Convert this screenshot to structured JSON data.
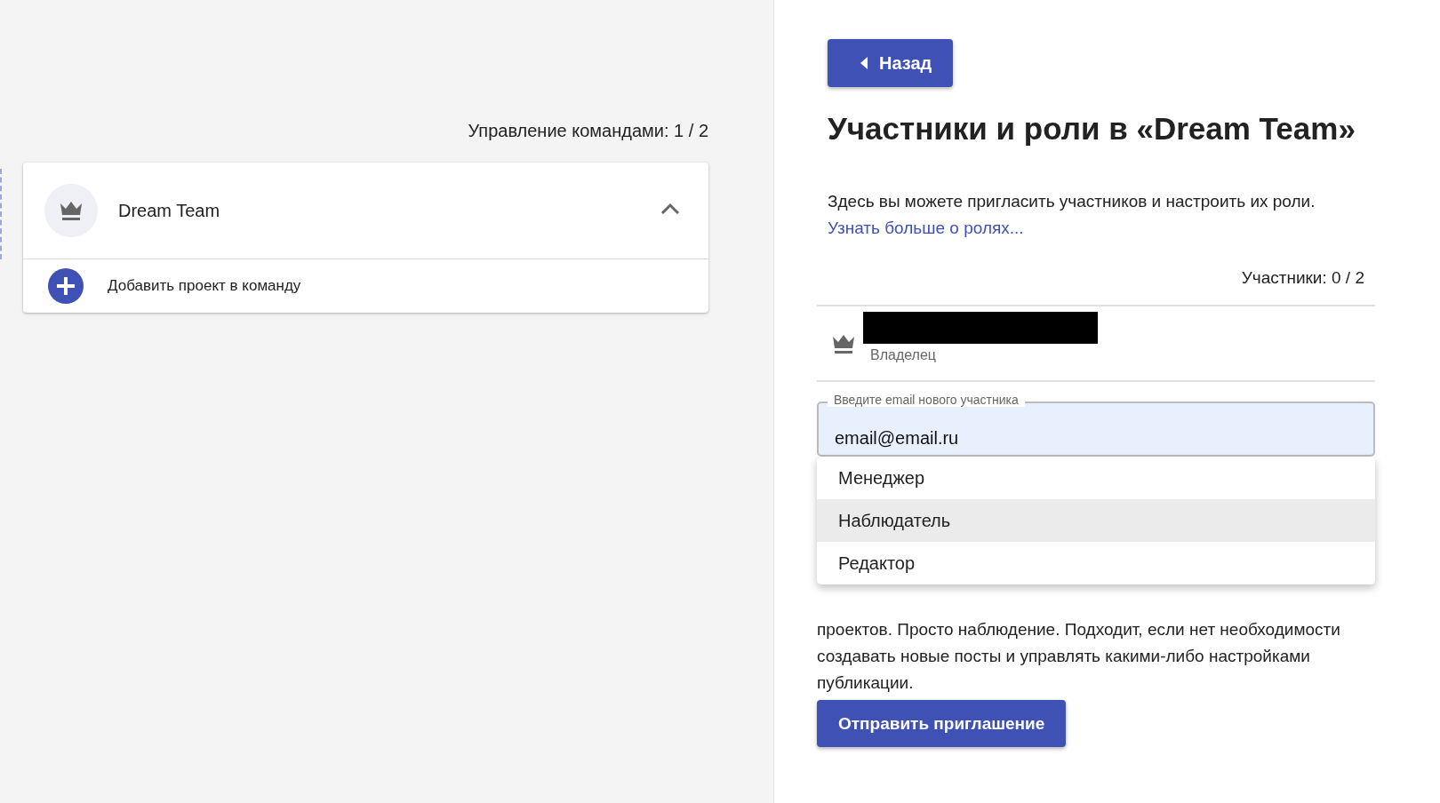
{
  "left_panel": {
    "counter": "Управление командами: 1 / 2",
    "team_card": {
      "name": "Dream Team",
      "expanded": true,
      "add_project": "Добавить проект в команду"
    }
  },
  "right_panel": {
    "back_button": "Назад",
    "title": "Участники и роли в «Dream Team»",
    "intro": "Здесь вы можете пригласить участников и настроить их роли.",
    "learn_more_link": "Узнать больше о ролях...",
    "members_counter": "Участники: 0 / 2",
    "members": [
      {
        "role": "Владелец",
        "redacted": true
      }
    ],
    "email_field": {
      "label": "Введите email нового участника",
      "value": "email@email.ru"
    },
    "role_menu": [
      {
        "label": "Менеджер",
        "selected": false
      },
      {
        "label": "Наблюдатель",
        "selected": true
      },
      {
        "label": "Редактор",
        "selected": false
      }
    ],
    "role_description": "проектов. Просто наблюдение. Подходит, если нет необходимости создавать новые посты и управлять какими-либо настройками публикации.",
    "send_button": "Отправить приглашение"
  }
}
